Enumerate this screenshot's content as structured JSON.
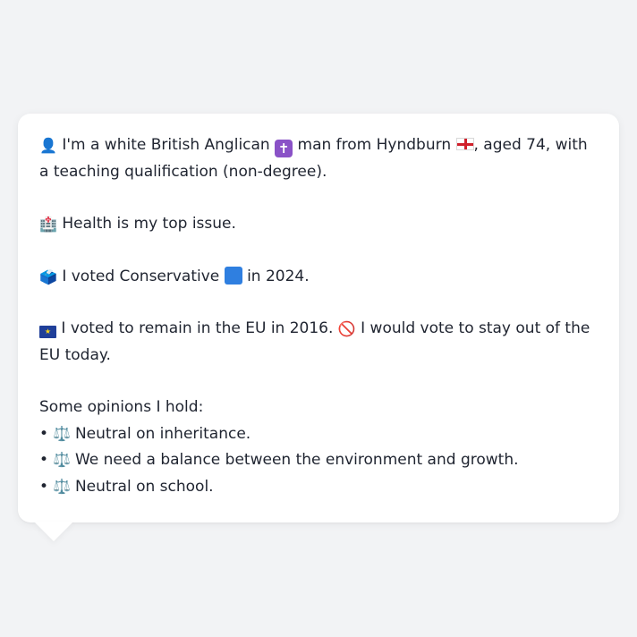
{
  "profile": {
    "identity_icon": "👤",
    "identity_text_1": " I'm a white British Anglican ",
    "religion_icon": "✝",
    "identity_text_2": " man from Hyndburn ",
    "identity_text_3": ", aged 74, with a teaching qualification (non-degree).",
    "issue_icon": "🏥",
    "issue_text": " Health is my top issue.",
    "vote_icon": "🗳️",
    "vote_text_1": " I voted Conservative ",
    "vote_text_2": " in 2024.",
    "eu_icon": "★",
    "eu_text_1": " I voted to remain in the EU in 2016. ",
    "no_icon": "🚫",
    "eu_text_2": " I would vote to stay out of the EU today.",
    "opinions_title": "Some opinions I hold:",
    "opinions": [
      {
        "bullet": "•",
        "icon": "⚖️",
        "text": "Neutral on inheritance."
      },
      {
        "bullet": "•",
        "icon": "⚖️",
        "text": "We need a balance between the environment and growth."
      },
      {
        "bullet": "•",
        "icon": "⚖️",
        "text": "Neutral on school."
      }
    ]
  },
  "colors": {
    "page_background": "#f2f3f5",
    "bubble_background": "#ffffff",
    "conservative_blue": "#2f7fe0",
    "religion_purple": "#8a52c7",
    "england_red": "#d0202b",
    "eu_blue": "#1f3f99"
  },
  "icons": {
    "identity": "person-silhouette-icon",
    "religion": "latin-cross-icon",
    "england": "england-flag-icon",
    "health": "hospital-icon",
    "vote": "ballot-box-icon",
    "party": "blue-square-icon",
    "eu": "eu-flag-icon",
    "no": "prohibited-icon",
    "balance": "balance-scale-icon"
  }
}
